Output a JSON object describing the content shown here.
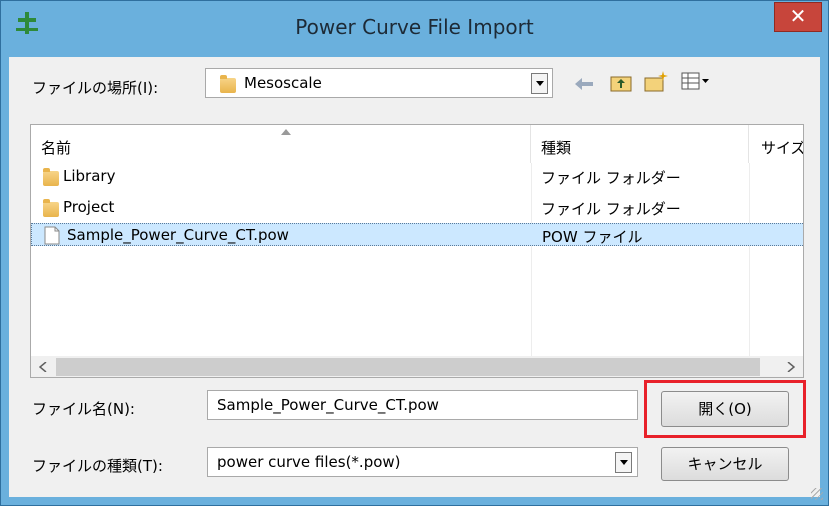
{
  "window": {
    "title": "Power Curve File Import",
    "close_glyph": "✕",
    "app_icon": "wind-turbine-app-icon"
  },
  "location": {
    "label": "ファイルの場所(I):",
    "current_folder": "Mesoscale",
    "toolbar_icons": [
      "back-arrow-icon",
      "up-folder-icon",
      "new-folder-icon",
      "view-menu-icon"
    ]
  },
  "file_list": {
    "columns": [
      "名前",
      "種類",
      "サイズ"
    ],
    "rows": [
      {
        "name": "Library",
        "type": "ファイル フォルダー",
        "icon": "folder-icon"
      },
      {
        "name": "Project",
        "type": "ファイル フォルダー",
        "icon": "folder-icon"
      },
      {
        "name": "Sample_Power_Curve_CT.pow",
        "type": "POW ファイル",
        "icon": "file-icon",
        "selected": true
      }
    ]
  },
  "filename": {
    "label": "ファイル名(N):",
    "value": "Sample_Power_Curve_CT.pow"
  },
  "filetype": {
    "label": "ファイルの種類(T):",
    "value": "power curve files(*.pow)"
  },
  "buttons": {
    "open_label": "開く(O)",
    "cancel_label": "キャンセル"
  },
  "colors": {
    "frame": "#6ab0dd",
    "close": "#c7453b",
    "selection": "#cce8ff",
    "highlight_box": "#e8212a"
  }
}
